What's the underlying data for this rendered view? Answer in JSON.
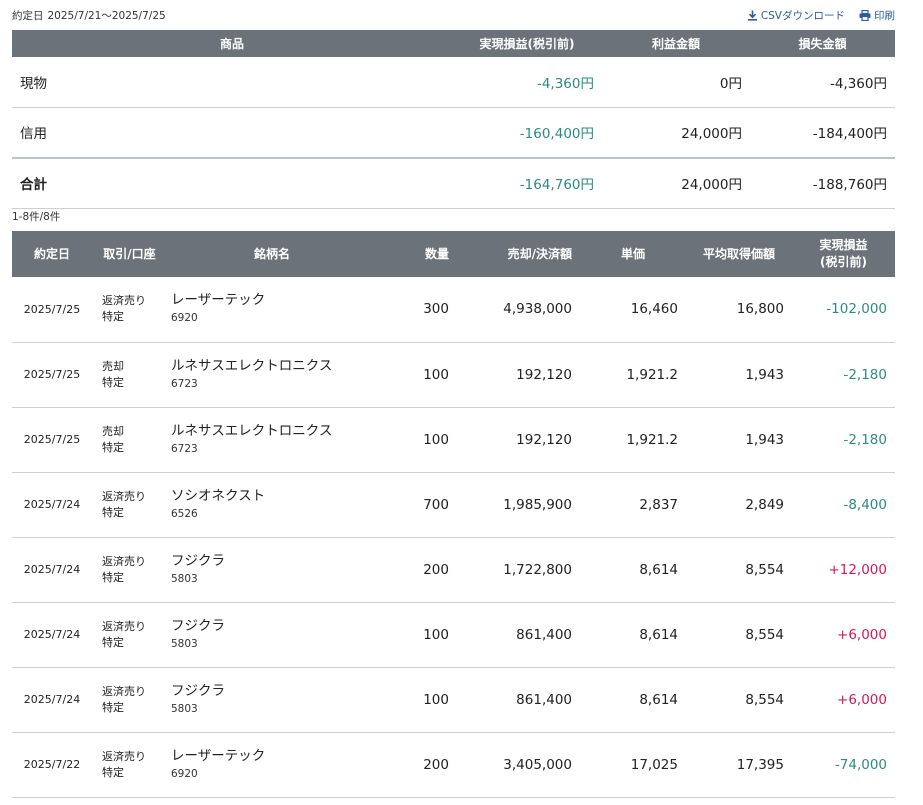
{
  "period": {
    "label": "約定日",
    "value": "2025/7/21〜2025/7/25"
  },
  "links": {
    "csv": "CSVダウンロード",
    "print": "印刷"
  },
  "summary": {
    "headers": {
      "product": "商品",
      "realized": "実現損益(税引前)",
      "profit": "利益金額",
      "loss": "損失金額"
    },
    "rows": [
      {
        "product": "現物",
        "realized": "-4,360円",
        "profit": "0円",
        "loss": "-4,360円"
      },
      {
        "product": "信用",
        "realized": "-160,400円",
        "profit": "24,000円",
        "loss": "-184,400円"
      }
    ],
    "total": {
      "product": "合計",
      "realized": "-164,760円",
      "profit": "24,000円",
      "loss": "-188,760円"
    }
  },
  "count_text": "1-8件/8件",
  "detail": {
    "headers": {
      "date": "約定日",
      "trade": "取引/口座",
      "stock": "銘柄名",
      "qty": "数量",
      "amount": "売却/決済額",
      "price": "単価",
      "avg": "平均取得価額",
      "pl_line1": "実現損益",
      "pl_line2": "(税引前)"
    },
    "rows": [
      {
        "date": "2025/7/25",
        "trade": "返済売り",
        "account": "特定",
        "name": "レーザーテック",
        "code": "6920",
        "qty": "300",
        "amount": "4,938,000",
        "price": "16,460",
        "avg": "16,800",
        "pl": "-102,000",
        "sign": "neg"
      },
      {
        "date": "2025/7/25",
        "trade": "売却",
        "account": "特定",
        "name": "ルネサスエレクトロニクス",
        "code": "6723",
        "qty": "100",
        "amount": "192,120",
        "price": "1,921.2",
        "avg": "1,943",
        "pl": "-2,180",
        "sign": "neg"
      },
      {
        "date": "2025/7/25",
        "trade": "売却",
        "account": "特定",
        "name": "ルネサスエレクトロニクス",
        "code": "6723",
        "qty": "100",
        "amount": "192,120",
        "price": "1,921.2",
        "avg": "1,943",
        "pl": "-2,180",
        "sign": "neg"
      },
      {
        "date": "2025/7/24",
        "trade": "返済売り",
        "account": "特定",
        "name": "ソシオネクスト",
        "code": "6526",
        "qty": "700",
        "amount": "1,985,900",
        "price": "2,837",
        "avg": "2,849",
        "pl": "-8,400",
        "sign": "neg"
      },
      {
        "date": "2025/7/24",
        "trade": "返済売り",
        "account": "特定",
        "name": "フジクラ",
        "code": "5803",
        "qty": "200",
        "amount": "1,722,800",
        "price": "8,614",
        "avg": "8,554",
        "pl": "+12,000",
        "sign": "pos"
      },
      {
        "date": "2025/7/24",
        "trade": "返済売り",
        "account": "特定",
        "name": "フジクラ",
        "code": "5803",
        "qty": "100",
        "amount": "861,400",
        "price": "8,614",
        "avg": "8,554",
        "pl": "+6,000",
        "sign": "pos"
      },
      {
        "date": "2025/7/24",
        "trade": "返済売り",
        "account": "特定",
        "name": "フジクラ",
        "code": "5803",
        "qty": "100",
        "amount": "861,400",
        "price": "8,614",
        "avg": "8,554",
        "pl": "+6,000",
        "sign": "pos"
      },
      {
        "date": "2025/7/22",
        "trade": "返済売り",
        "account": "特定",
        "name": "レーザーテック",
        "code": "6920",
        "qty": "200",
        "amount": "3,405,000",
        "price": "17,025",
        "avg": "17,395",
        "pl": "-74,000",
        "sign": "neg"
      }
    ]
  },
  "colors": {
    "header_bg": "#6c727a",
    "loss": "#2b8a85",
    "gain": "#d21a55",
    "link": "#2a5ca8"
  },
  "icons": {
    "csv": "download-icon",
    "print": "printer-icon"
  }
}
